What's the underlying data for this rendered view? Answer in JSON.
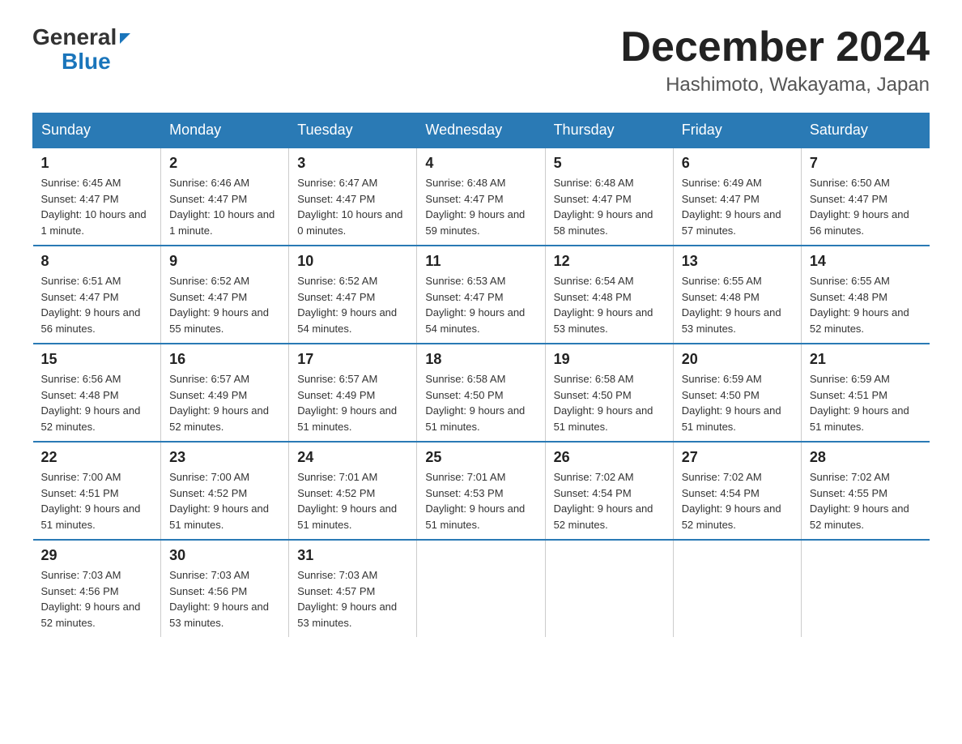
{
  "logo": {
    "general": "General",
    "blue": "Blue"
  },
  "header": {
    "month": "December 2024",
    "location": "Hashimoto, Wakayama, Japan"
  },
  "days_header": [
    "Sunday",
    "Monday",
    "Tuesday",
    "Wednesday",
    "Thursday",
    "Friday",
    "Saturday"
  ],
  "weeks": [
    [
      {
        "num": "1",
        "sunrise": "6:45 AM",
        "sunset": "4:47 PM",
        "daylight": "10 hours and 1 minute."
      },
      {
        "num": "2",
        "sunrise": "6:46 AM",
        "sunset": "4:47 PM",
        "daylight": "10 hours and 1 minute."
      },
      {
        "num": "3",
        "sunrise": "6:47 AM",
        "sunset": "4:47 PM",
        "daylight": "10 hours and 0 minutes."
      },
      {
        "num": "4",
        "sunrise": "6:48 AM",
        "sunset": "4:47 PM",
        "daylight": "9 hours and 59 minutes."
      },
      {
        "num": "5",
        "sunrise": "6:48 AM",
        "sunset": "4:47 PM",
        "daylight": "9 hours and 58 minutes."
      },
      {
        "num": "6",
        "sunrise": "6:49 AM",
        "sunset": "4:47 PM",
        "daylight": "9 hours and 57 minutes."
      },
      {
        "num": "7",
        "sunrise": "6:50 AM",
        "sunset": "4:47 PM",
        "daylight": "9 hours and 56 minutes."
      }
    ],
    [
      {
        "num": "8",
        "sunrise": "6:51 AM",
        "sunset": "4:47 PM",
        "daylight": "9 hours and 56 minutes."
      },
      {
        "num": "9",
        "sunrise": "6:52 AM",
        "sunset": "4:47 PM",
        "daylight": "9 hours and 55 minutes."
      },
      {
        "num": "10",
        "sunrise": "6:52 AM",
        "sunset": "4:47 PM",
        "daylight": "9 hours and 54 minutes."
      },
      {
        "num": "11",
        "sunrise": "6:53 AM",
        "sunset": "4:47 PM",
        "daylight": "9 hours and 54 minutes."
      },
      {
        "num": "12",
        "sunrise": "6:54 AM",
        "sunset": "4:48 PM",
        "daylight": "9 hours and 53 minutes."
      },
      {
        "num": "13",
        "sunrise": "6:55 AM",
        "sunset": "4:48 PM",
        "daylight": "9 hours and 53 minutes."
      },
      {
        "num": "14",
        "sunrise": "6:55 AM",
        "sunset": "4:48 PM",
        "daylight": "9 hours and 52 minutes."
      }
    ],
    [
      {
        "num": "15",
        "sunrise": "6:56 AM",
        "sunset": "4:48 PM",
        "daylight": "9 hours and 52 minutes."
      },
      {
        "num": "16",
        "sunrise": "6:57 AM",
        "sunset": "4:49 PM",
        "daylight": "9 hours and 52 minutes."
      },
      {
        "num": "17",
        "sunrise": "6:57 AM",
        "sunset": "4:49 PM",
        "daylight": "9 hours and 51 minutes."
      },
      {
        "num": "18",
        "sunrise": "6:58 AM",
        "sunset": "4:50 PM",
        "daylight": "9 hours and 51 minutes."
      },
      {
        "num": "19",
        "sunrise": "6:58 AM",
        "sunset": "4:50 PM",
        "daylight": "9 hours and 51 minutes."
      },
      {
        "num": "20",
        "sunrise": "6:59 AM",
        "sunset": "4:50 PM",
        "daylight": "9 hours and 51 minutes."
      },
      {
        "num": "21",
        "sunrise": "6:59 AM",
        "sunset": "4:51 PM",
        "daylight": "9 hours and 51 minutes."
      }
    ],
    [
      {
        "num": "22",
        "sunrise": "7:00 AM",
        "sunset": "4:51 PM",
        "daylight": "9 hours and 51 minutes."
      },
      {
        "num": "23",
        "sunrise": "7:00 AM",
        "sunset": "4:52 PM",
        "daylight": "9 hours and 51 minutes."
      },
      {
        "num": "24",
        "sunrise": "7:01 AM",
        "sunset": "4:52 PM",
        "daylight": "9 hours and 51 minutes."
      },
      {
        "num": "25",
        "sunrise": "7:01 AM",
        "sunset": "4:53 PM",
        "daylight": "9 hours and 51 minutes."
      },
      {
        "num": "26",
        "sunrise": "7:02 AM",
        "sunset": "4:54 PM",
        "daylight": "9 hours and 52 minutes."
      },
      {
        "num": "27",
        "sunrise": "7:02 AM",
        "sunset": "4:54 PM",
        "daylight": "9 hours and 52 minutes."
      },
      {
        "num": "28",
        "sunrise": "7:02 AM",
        "sunset": "4:55 PM",
        "daylight": "9 hours and 52 minutes."
      }
    ],
    [
      {
        "num": "29",
        "sunrise": "7:03 AM",
        "sunset": "4:56 PM",
        "daylight": "9 hours and 52 minutes."
      },
      {
        "num": "30",
        "sunrise": "7:03 AM",
        "sunset": "4:56 PM",
        "daylight": "9 hours and 53 minutes."
      },
      {
        "num": "31",
        "sunrise": "7:03 AM",
        "sunset": "4:57 PM",
        "daylight": "9 hours and 53 minutes."
      },
      null,
      null,
      null,
      null
    ]
  ]
}
